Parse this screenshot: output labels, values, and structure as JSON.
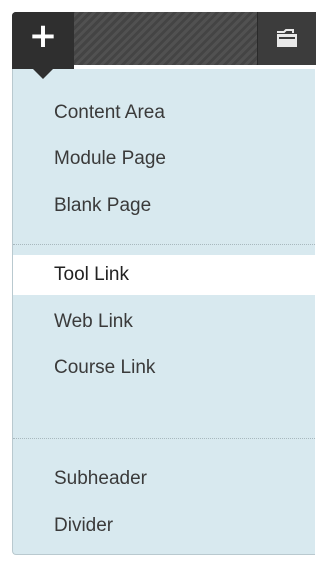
{
  "toolbar": {
    "add_icon_glyph": "+",
    "add_icon_name": "plus-icon",
    "folder_icon_name": "folder-icon"
  },
  "menu": {
    "groups": [
      [
        "Content Area",
        "Module Page",
        "Blank Page"
      ],
      [
        "Tool Link",
        "Web Link",
        "Course Link"
      ],
      [
        "Subheader",
        "Divider"
      ]
    ],
    "highlighted_item": "Tool Link"
  },
  "colors": {
    "toolbar_bg": "#4a4a4a",
    "add_tab_bg": "#2f2f2f",
    "menu_bg": "#d8e9ef",
    "highlight_bg": "#ffffff",
    "text": "#3a3a3a"
  }
}
